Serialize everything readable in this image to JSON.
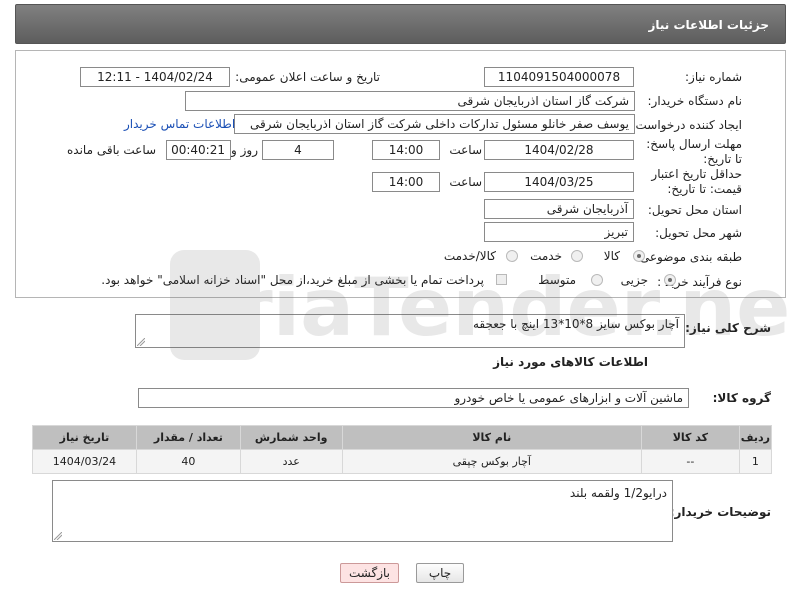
{
  "page": {
    "title": "جزئیات اطلاعات نیاز"
  },
  "form": {
    "need_number": {
      "label": "شماره نیاز:",
      "value": "1104091504000078"
    },
    "announce_datetime": {
      "label": "تاریخ و ساعت اعلان عمومی:",
      "value": "1404/02/24 - 12:11"
    },
    "buyer_org": {
      "label": "نام دستگاه خریدار:",
      "value": "شرکت گاز استان اذربایجان شرقی"
    },
    "creator": {
      "label": "ایجاد کننده درخواست:",
      "value": "یوسف صفر خانلو  مسئول تدارکات داخلی  شرکت گاز استان اذربایجان شرقی",
      "contact_link": "اطلاعات تماس خریدار"
    },
    "reply_deadline": {
      "label": "مهلت ارسال پاسخ: تا تاریخ:",
      "date": "1404/02/28",
      "time_label": "ساعت",
      "time": "14:00",
      "days": "4",
      "days_label": "روز و",
      "remaining": "00:40:21",
      "remaining_label": "ساعت باقی مانده"
    },
    "price_validity": {
      "label": "حداقل تاریخ اعتبار قیمت: تا تاریخ:",
      "date": "1404/03/25",
      "time_label": "ساعت",
      "time": "14:00"
    },
    "delivery_province": {
      "label": "استان محل تحویل:",
      "value": "آذربایجان شرقی"
    },
    "delivery_city": {
      "label": "شهر محل تحویل:",
      "value": "تبریز"
    },
    "category": {
      "label": "طبقه بندی موضوعی:",
      "options": [
        "کالا",
        "خدمت",
        "کالا/خدمت"
      ],
      "selected": "کالا"
    },
    "purchase_process": {
      "label": "نوع فرآیند خرید :",
      "options": [
        "جزیی",
        "متوسط"
      ],
      "selected": "جزیی",
      "note": "پرداخت تمام یا بخشی از مبلغ خرید،از محل \"اسناد خزانه اسلامی\" خواهد بود."
    }
  },
  "description": {
    "label": "شرح کلی نیاز:",
    "value": "آچار بوکس سایز 8*10*13 اینچ با جعجقه"
  },
  "goods_info": {
    "heading": "اطلاعات کالاهای مورد نیاز"
  },
  "goods_group": {
    "label": "گروه کالا:",
    "value": "ماشین آلات و ابزارهای عمومی یا خاص خودرو"
  },
  "table": {
    "headers": [
      "ردیف",
      "کد کالا",
      "نام کالا",
      "واحد شمارش",
      "تعداد / مقدار",
      "تاریخ نیاز"
    ],
    "rows": [
      [
        "1",
        "--",
        "آچار بوکس چپقی",
        "عدد",
        "40",
        "1404/03/24"
      ]
    ]
  },
  "buyer_notes": {
    "label": "توضیحات خریدار:",
    "value": "درایو1/2 ولقمه بلند"
  },
  "buttons": {
    "print": "چاپ",
    "back": "بازگشت"
  },
  "watermark": {
    "text": "AriaTender.net"
  }
}
